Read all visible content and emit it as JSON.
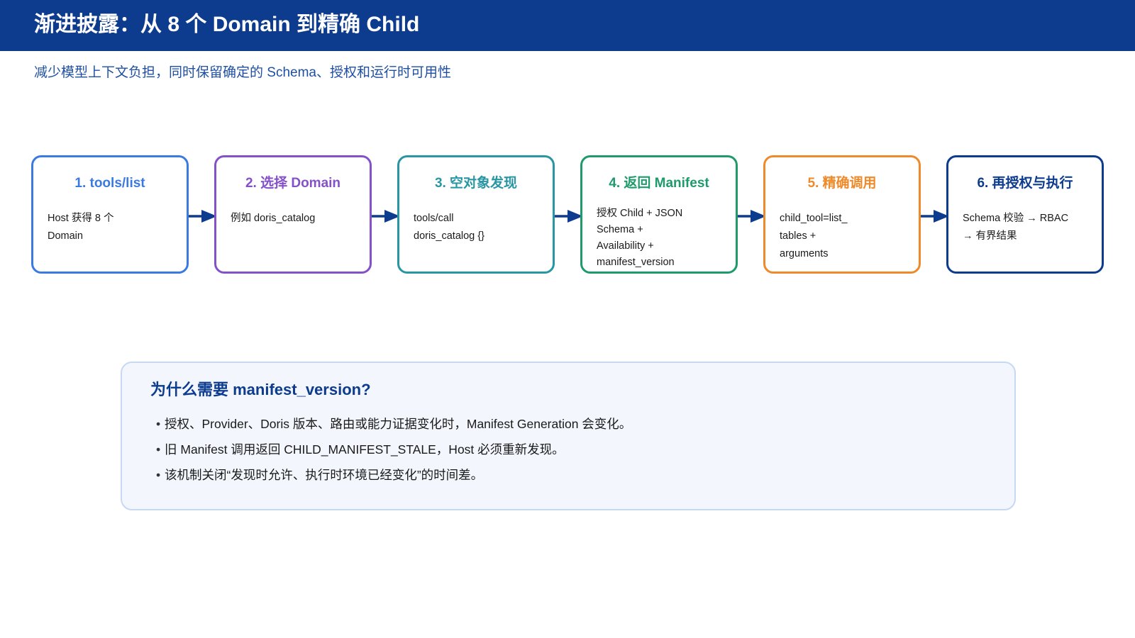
{
  "header": {
    "title": "渐进披露：从 8 个 Domain 到精确 Child"
  },
  "subtitle": "减少模型上下文负担，同时保留确定的 Schema、授权和运行时可用性",
  "steps": [
    {
      "title": "1. tools/list",
      "body": "Host 获得 8 个\nDomain",
      "color": "#3b7ae0"
    },
    {
      "title": "2. 选择 Domain",
      "body": "例如 doris_catalog",
      "color": "#8451c9"
    },
    {
      "title": "3. 空对象发现",
      "body": "tools/call\ndoris_catalog {}",
      "color": "#2896a3"
    },
    {
      "title": "4. 返回 Manifest",
      "body": "授权 Child + JSON\nSchema +\nAvailability +\nmanifest_version",
      "color": "#1e9a6b"
    },
    {
      "title": "5. 精确调用",
      "body": "child_tool=list_\ntables +\narguments",
      "color": "#ef8a2a"
    },
    {
      "title": "6. 再授权与执行",
      "body": "Schema 校验 → RBAC\n→ 有界结果",
      "color": "#0d3b8e"
    }
  ],
  "arrow_color": "#0d3b8e",
  "note": {
    "title": "为什么需要 manifest_version?",
    "bullet": "•",
    "items": [
      "授权、Provider、Doris 版本、路由或能力证据变化时，Manifest Generation 会变化。",
      "旧 Manifest 调用返回 CHILD_MANIFEST_STALE，Host 必须重新发现。",
      "该机制关闭“发现时允许、执行时环境已经变化”的时间差。"
    ]
  }
}
